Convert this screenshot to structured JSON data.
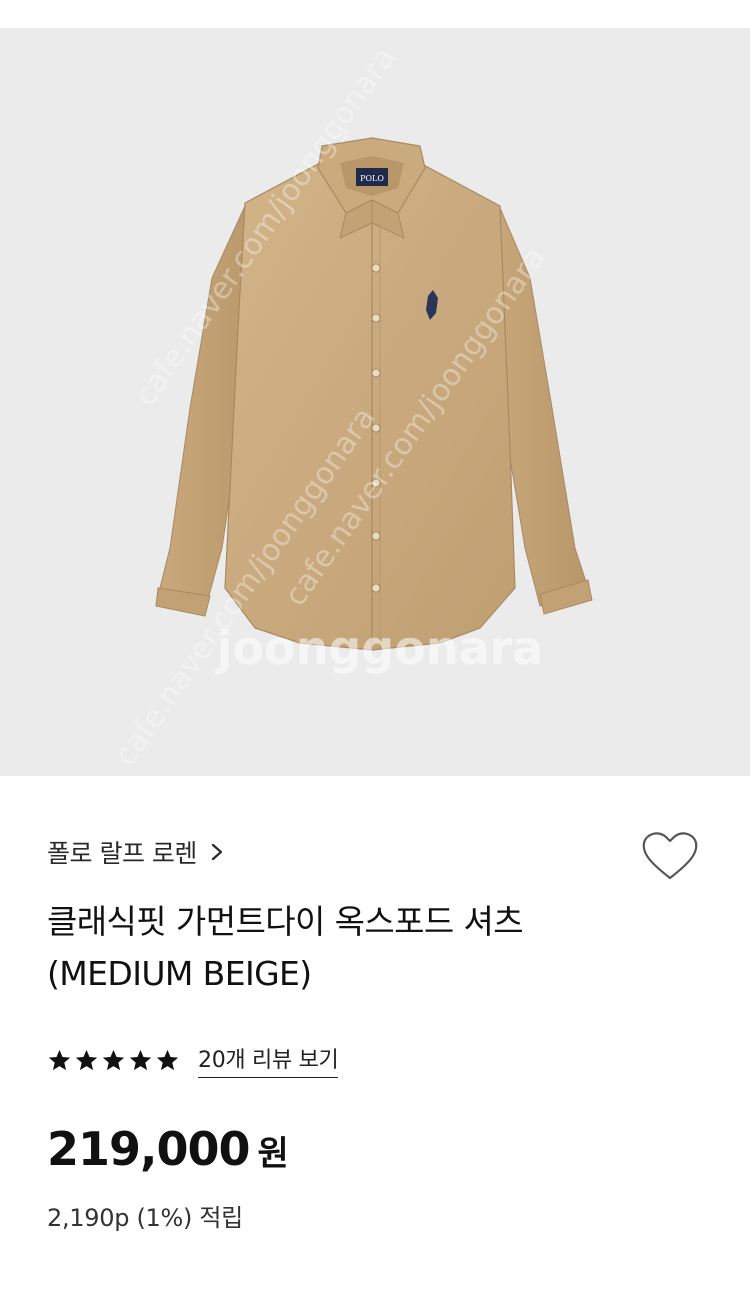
{
  "product": {
    "image_alt_icon": "shirt-photo",
    "image_watermark": "cafe.naver.com/joonggonara",
    "brand": "폴로 랄프 로렌",
    "title_line1": "클래식핏 가먼트다이 옥스포드 셔츠",
    "title_line2": "(MEDIUM BEIGE)",
    "rating_stars": 5,
    "review_link": "20개 리뷰 보기",
    "price": "219,000",
    "price_unit": "원",
    "points": "2,190p (1%) 적립"
  },
  "icons": {
    "brand_chevron": "chevron-right-icon",
    "wishlist": "heart-outline-icon",
    "star": "star-filled-icon"
  },
  "colors": {
    "image_background": "#ebebeb",
    "shirt": "#c8a97c",
    "text": "#111111",
    "star": "#111111"
  }
}
